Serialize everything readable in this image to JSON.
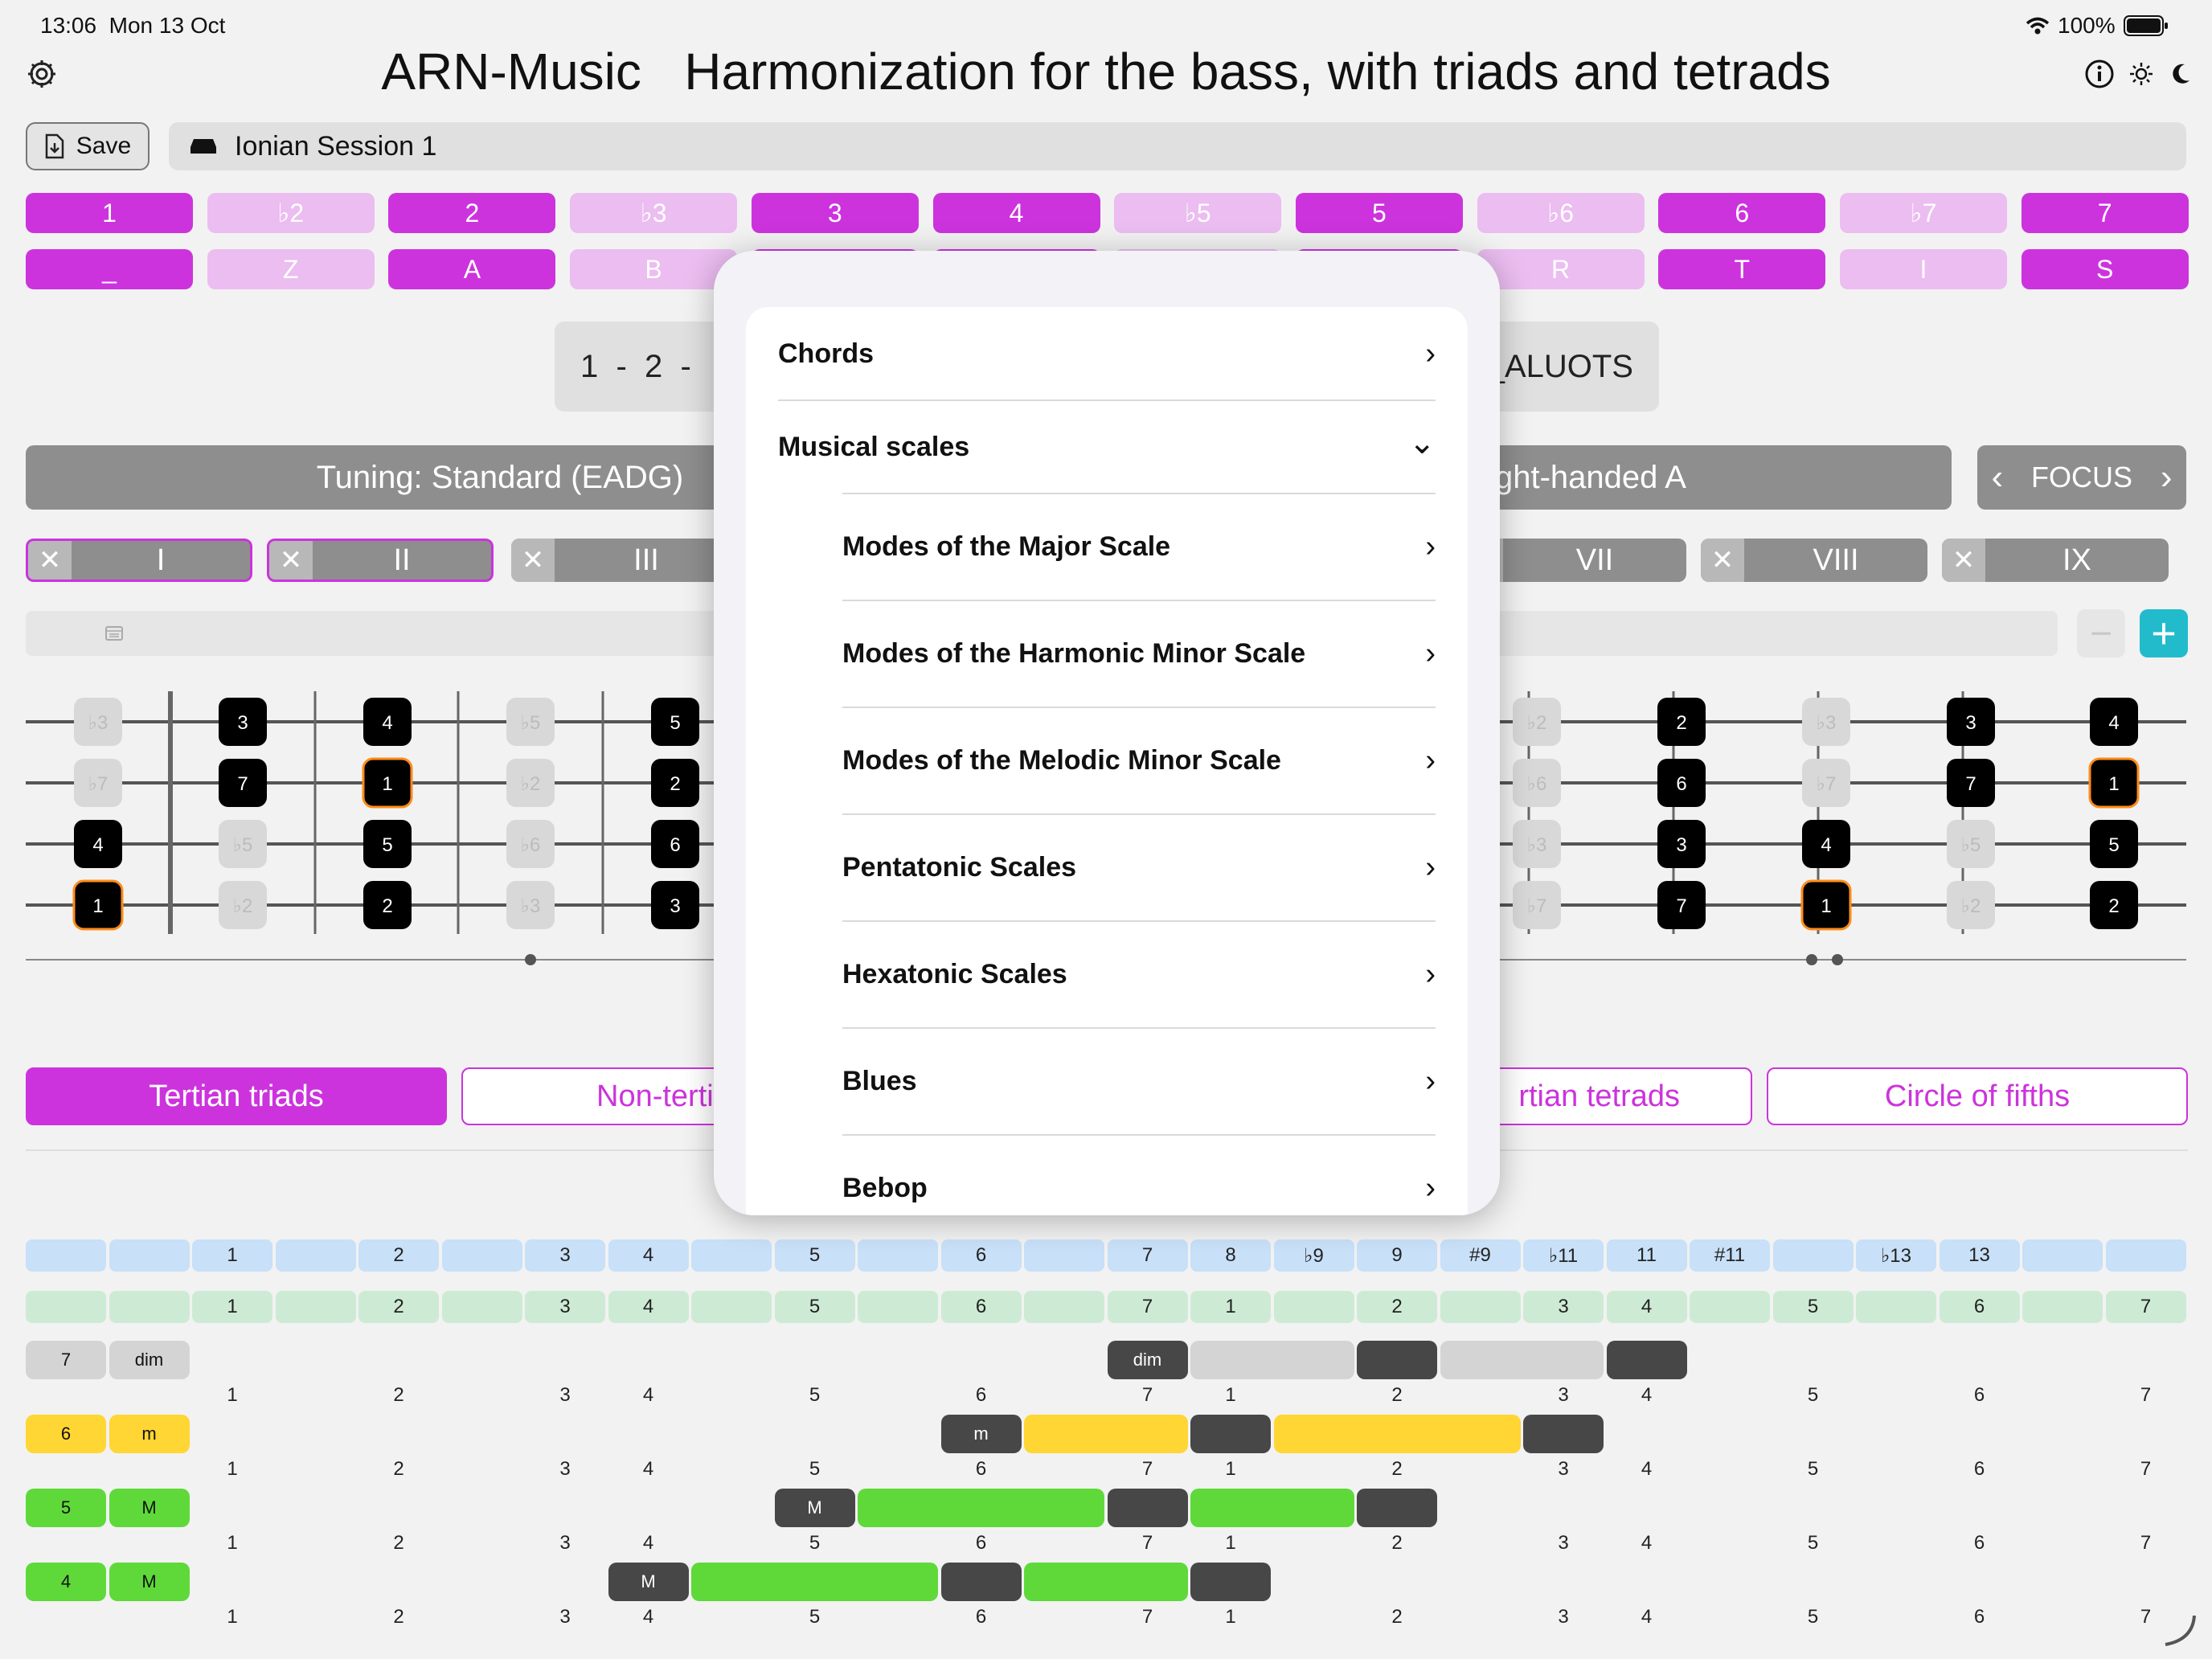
{
  "status_bar": {
    "time": "13:06",
    "date": "Mon 13 Oct",
    "battery": "100%"
  },
  "header": {
    "title": "ARN-Music   Harmonization for the bass, with triads and tetrads",
    "left_icon": "gear-icon",
    "right_icons": [
      "info-icon",
      "sun-icon",
      "moon-icon"
    ]
  },
  "toolbar": {
    "save_label": "Save",
    "session_name": "Ionian Session 1"
  },
  "degree_buttons": [
    {
      "label": "1",
      "on": true
    },
    {
      "label": "♭2",
      "on": false
    },
    {
      "label": "2",
      "on": true
    },
    {
      "label": "♭3",
      "on": false
    },
    {
      "label": "3",
      "on": true
    },
    {
      "label": "4",
      "on": true
    },
    {
      "label": "♭5",
      "on": false
    },
    {
      "label": "5",
      "on": true
    },
    {
      "label": "♭6",
      "on": false
    },
    {
      "label": "6",
      "on": true
    },
    {
      "label": "♭7",
      "on": false
    },
    {
      "label": "7",
      "on": true
    }
  ],
  "letter_buttons": [
    {
      "label": "_",
      "on": true
    },
    {
      "label": "Z",
      "on": false
    },
    {
      "label": "A",
      "on": true
    },
    {
      "label": "B",
      "on": false
    },
    {
      "label": "",
      "on": true
    },
    {
      "label": "",
      "on": true
    },
    {
      "label": "",
      "on": false
    },
    {
      "label": "",
      "on": true
    },
    {
      "label": "R",
      "on": false
    },
    {
      "label": "T",
      "on": true
    },
    {
      "label": "I",
      "on": false
    },
    {
      "label": "S",
      "on": true
    }
  ],
  "sequence": {
    "left": "1  -  2  -",
    "right": "_ALUOTS"
  },
  "tuning": {
    "label": "Tuning: Standard (EADG)",
    "hand": "ght-handed A",
    "focus": "FOCUS"
  },
  "strings": [
    {
      "label": "I",
      "selected": true
    },
    {
      "label": "II",
      "selected": true
    },
    {
      "label": "III",
      "selected": false
    },
    {
      "label": "VII",
      "selected": false
    },
    {
      "label": "VIII",
      "selected": false
    },
    {
      "label": "IX",
      "selected": false
    }
  ],
  "fretboard_notes": {
    "left": [
      [
        [
          "♭3",
          "g"
        ],
        [
          "3",
          "b"
        ],
        [
          "4",
          "b"
        ],
        [
          "♭5",
          "g"
        ],
        [
          "5",
          "b"
        ]
      ],
      [
        [
          "♭7",
          "g"
        ],
        [
          "7",
          "b"
        ],
        [
          "1",
          "r"
        ],
        [
          "♭2",
          "g"
        ],
        [
          "2",
          "b"
        ]
      ],
      [
        [
          "4",
          "b"
        ],
        [
          "♭5",
          "g"
        ],
        [
          "5",
          "b"
        ],
        [
          "♭6",
          "g"
        ],
        [
          "6",
          "b"
        ]
      ],
      [
        [
          "1",
          "r"
        ],
        [
          "♭2",
          "g"
        ],
        [
          "2",
          "b"
        ],
        [
          "♭3",
          "g"
        ],
        [
          "3",
          "b"
        ]
      ]
    ],
    "right": [
      [
        [
          "♭2",
          "g"
        ],
        [
          "2",
          "b"
        ],
        [
          "♭3",
          "g"
        ],
        [
          "3",
          "b"
        ],
        [
          "4",
          "b"
        ]
      ],
      [
        [
          "♭6",
          "g"
        ],
        [
          "6",
          "b"
        ],
        [
          "♭7",
          "g"
        ],
        [
          "7",
          "b"
        ],
        [
          "1",
          "r"
        ]
      ],
      [
        [
          "♭3",
          "g"
        ],
        [
          "3",
          "b"
        ],
        [
          "4",
          "b"
        ],
        [
          "♭5",
          "g"
        ],
        [
          "5",
          "b"
        ]
      ],
      [
        [
          "♭7",
          "g"
        ],
        [
          "7",
          "b"
        ],
        [
          "1",
          "r"
        ],
        [
          "♭2",
          "g"
        ],
        [
          "2",
          "b"
        ]
      ]
    ]
  },
  "tabs": [
    {
      "label": "Tertian triads",
      "active": true
    },
    {
      "label": "Non-tertian",
      "active": false
    },
    {
      "label": "rtian tetrads",
      "active": false
    },
    {
      "label": "Circle of fifths",
      "active": false
    }
  ],
  "interval_row": [
    "",
    "",
    "1",
    "",
    "2",
    "",
    "3",
    "4",
    "",
    "5",
    "",
    "6",
    "",
    "7",
    "8",
    "♭9",
    "9",
    "#9",
    "♭11",
    "11",
    "#11",
    "",
    "♭13",
    "13",
    "",
    ""
  ],
  "degree_row": [
    "",
    "",
    "1",
    "",
    "2",
    "",
    "3",
    "4",
    "",
    "5",
    "",
    "6",
    "",
    "7",
    "1",
    "",
    "2",
    "",
    "3",
    "4",
    "",
    "5",
    "",
    "6",
    "",
    "7"
  ],
  "chord_rows": [
    {
      "degree": "7",
      "quality": "dim",
      "color": "#d4d4d4",
      "segments": [
        {
          "c": 13,
          "span": 1,
          "t": "d",
          "label": "dim"
        },
        {
          "c": 14,
          "span": 2,
          "t": "l"
        },
        {
          "c": 16,
          "span": 1,
          "t": "d"
        },
        {
          "c": 17,
          "span": 2,
          "t": "l"
        },
        {
          "c": 19,
          "span": 1,
          "t": "d"
        }
      ]
    },
    {
      "degree": "6",
      "quality": "m",
      "color": "#ffd633",
      "segments": [
        {
          "c": 11,
          "span": 1,
          "t": "d",
          "label": "m"
        },
        {
          "c": 12,
          "span": 2,
          "t": "l"
        },
        {
          "c": 14,
          "span": 1,
          "t": "d"
        },
        {
          "c": 15,
          "span": 3,
          "t": "l"
        },
        {
          "c": 18,
          "span": 1,
          "t": "d"
        }
      ]
    },
    {
      "degree": "5",
      "quality": "M",
      "color": "#5fd93a",
      "segments": [
        {
          "c": 9,
          "span": 1,
          "t": "d",
          "label": "M"
        },
        {
          "c": 10,
          "span": 3,
          "t": "l"
        },
        {
          "c": 13,
          "span": 1,
          "t": "d"
        },
        {
          "c": 14,
          "span": 2,
          "t": "l"
        },
        {
          "c": 16,
          "span": 1,
          "t": "d"
        }
      ]
    },
    {
      "degree": "4",
      "quality": "M",
      "color": "#5fd93a",
      "segments": [
        {
          "c": 7,
          "span": 1,
          "t": "d",
          "label": "M"
        },
        {
          "c": 8,
          "span": 3,
          "t": "l"
        },
        {
          "c": 11,
          "span": 1,
          "t": "d"
        },
        {
          "c": 12,
          "span": 2,
          "t": "l"
        },
        {
          "c": 14,
          "span": 1,
          "t": "d"
        }
      ]
    }
  ],
  "number_row": [
    "1",
    "2",
    "3",
    "4",
    "5",
    "6",
    "7",
    "1",
    "2",
    "3",
    "4",
    "5",
    "6",
    "7"
  ],
  "popover": {
    "items": [
      {
        "label": "Chords",
        "indent": false,
        "chevron": "›"
      },
      {
        "label": "Musical scales",
        "indent": false,
        "chevron": "⌄"
      },
      {
        "label": "Modes of the Major Scale",
        "indent": true,
        "chevron": "›"
      },
      {
        "label": "Modes of the Harmonic Minor Scale",
        "indent": true,
        "chevron": "›"
      },
      {
        "label": "Modes of the Melodic Minor Scale",
        "indent": true,
        "chevron": "›"
      },
      {
        "label": "Pentatonic Scales",
        "indent": true,
        "chevron": "›"
      },
      {
        "label": "Hexatonic Scales",
        "indent": true,
        "chevron": "›"
      },
      {
        "label": "Blues",
        "indent": true,
        "chevron": "›"
      },
      {
        "label": "Bebop",
        "indent": true,
        "chevron": "›"
      }
    ]
  },
  "colors": {
    "accent": "#cc33dd",
    "accent_light": "#ebbdf0",
    "teal": "#22bbcc",
    "dark_segment": "#474747"
  }
}
